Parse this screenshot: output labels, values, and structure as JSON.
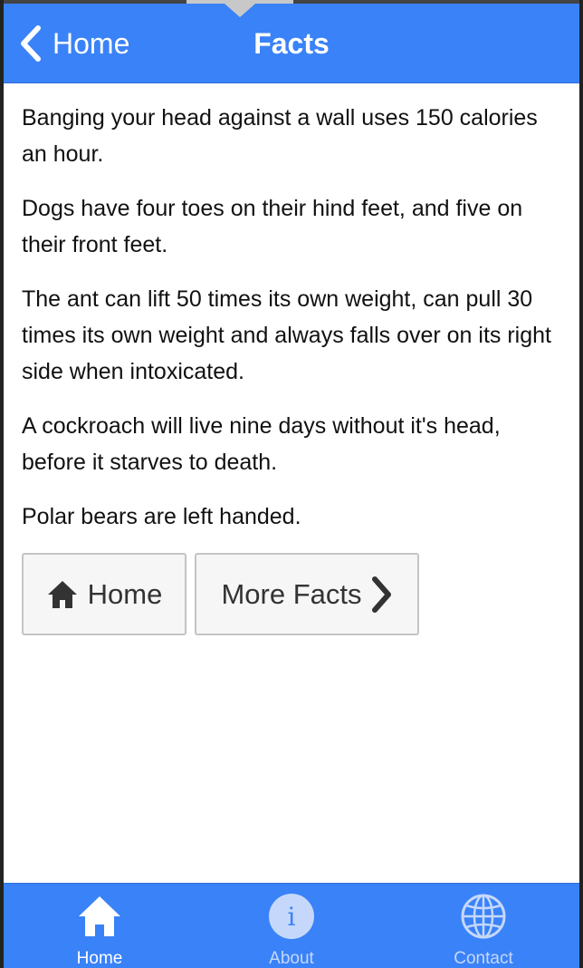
{
  "header": {
    "back_label": "Home",
    "title": "Facts"
  },
  "facts": [
    "Banging your head against a wall uses 150 calories an hour.",
    "Dogs have four toes on their hind feet, and five on their front feet.",
    "The ant can lift 50 times its own weight, can pull 30 times its own weight and always falls over on its right side when intoxicated.",
    "A cockroach will live nine days without it's head, before it starves to death.",
    "Polar bears are left handed."
  ],
  "buttons": {
    "home_label": "Home",
    "home_icon": "house-icon",
    "more_label": "More Facts",
    "more_icon": "chevron-right-icon"
  },
  "tabbar": {
    "tabs": [
      {
        "label": "Home",
        "icon": "house-icon",
        "active": true
      },
      {
        "label": "About",
        "icon": "info-icon",
        "active": false
      },
      {
        "label": "Contact",
        "icon": "globe-icon",
        "active": false
      }
    ]
  },
  "colors": {
    "accent": "#3a82f7",
    "button_bg": "#f6f6f6",
    "button_border": "#c4c4c4"
  }
}
